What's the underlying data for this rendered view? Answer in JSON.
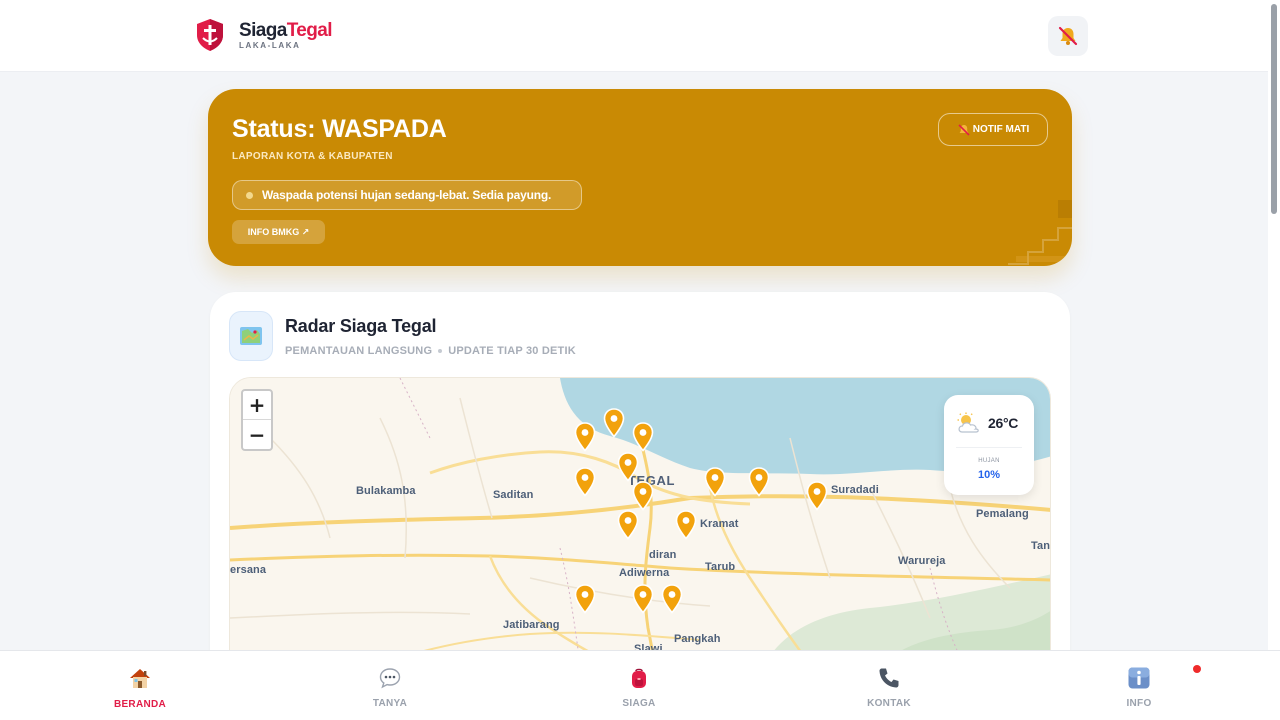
{
  "header": {
    "brand_part1": "Siaga",
    "brand_part2": "Tegal",
    "brand_sub": "LAKA-LAKA",
    "bell_icon": "bell-muted-icon"
  },
  "status": {
    "title": "Status: WASPADA",
    "subtitle": "LAPORAN KOTA & KABUPATEN",
    "notif_button": "NOTIF MATI",
    "alert_text": "Waspada potensi hujan sedang-lebat. Sedia payung.",
    "info_button": "INFO BMKG ↗",
    "card_color": "#c98a04"
  },
  "radar": {
    "title": "Radar Siaga Tegal",
    "sub1": "PEMANTAUAN LANGSUNG",
    "sub2": "UPDATE TIAP 30 DETIK",
    "icon": "map-icon"
  },
  "map": {
    "zoom_in": "+",
    "zoom_out": "−",
    "labels": {
      "bulakamba": "Bulakamba",
      "saditan": "Saditan",
      "tegal": "TEGAL",
      "suradadi": "Suradadi",
      "pemalang": "Pemalang",
      "kramat": "Kramat",
      "warureja": "Warureja",
      "tan": "Tan",
      "ersana": "ersana",
      "adiwerna": "Adiwerna",
      "tarub": "Tarub",
      "diran": "diran",
      "jatibarang": "Jatibarang",
      "slawi": "Slawi",
      "pangkah": "Pangkah"
    },
    "pin_count": 14,
    "pin_color": "#f2a20c"
  },
  "weather": {
    "icon": "partly-cloudy-icon",
    "temp": "26°C",
    "rain_label": "HUJAN",
    "rain_value": "10%"
  },
  "nav": {
    "items": [
      {
        "label": "BERANDA",
        "icon": "home-icon"
      },
      {
        "label": "TANYA",
        "icon": "chat-icon"
      },
      {
        "label": "SIAGA",
        "icon": "backpack-icon"
      },
      {
        "label": "KONTAK",
        "icon": "phone-icon"
      },
      {
        "label": "INFO",
        "icon": "info-icon"
      }
    ],
    "active_color": "#e11d48"
  }
}
